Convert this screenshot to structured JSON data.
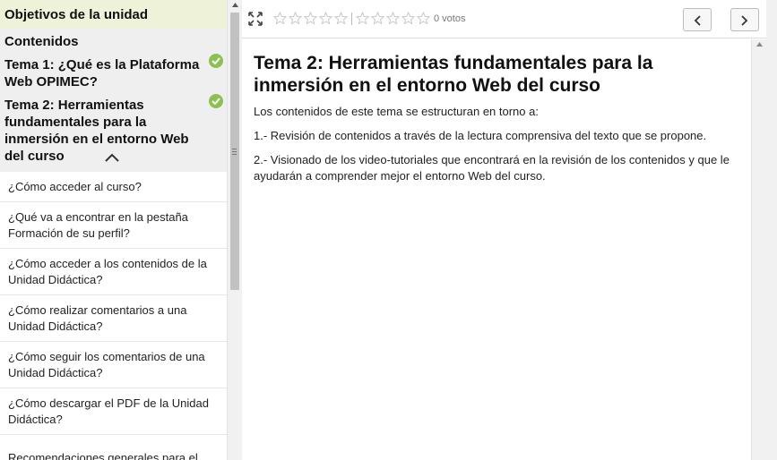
{
  "sidebar": {
    "objetivos": "Objetivos de la unidad",
    "contenidos": "Contenidos",
    "temas": [
      {
        "title": "Tema 1: ¿Qué es la Plataforma Web OPIMEC?"
      },
      {
        "title": "Tema 2: Herramientas fundamentales para la inmersión en el entorno Web del curso"
      }
    ],
    "items": [
      "¿Cómo acceder al curso?",
      "¿Qué va a encontrar en la pestaña Formación de su perfil?",
      "¿Cómo acceder a los contenidos de la Unidad Didáctica?",
      "¿Cómo realizar comentarios a una Unidad Didáctica?",
      "¿Cómo seguir los comentarios de una Unidad Didáctica?",
      "¿Cómo descargar el PDF de la Unidad Didáctica?",
      "Recomendaciones generales para el"
    ]
  },
  "toolbar": {
    "votes": "0 votos",
    "rating": 0,
    "star_count": 10
  },
  "main": {
    "title": "Tema 2: Herramientas fundamentales para la inmersión en el entorno Web del curso",
    "intro": "Los contenidos de este tema se estructuran en torno a:",
    "point1": "1.- Revisión de contenidos a través de la lectura comprensiva del texto que se propone.",
    "point2": "2.- Visionado de los video-tutoriales que encontrará en la revisión de los contenidos y que le ayudarán a comprender mejor el entorno Web del curso."
  },
  "colors": {
    "objetivos_bg": "#eef2d8",
    "sidebar_head_bg": "#efefef",
    "check_green": "#8cc152"
  }
}
